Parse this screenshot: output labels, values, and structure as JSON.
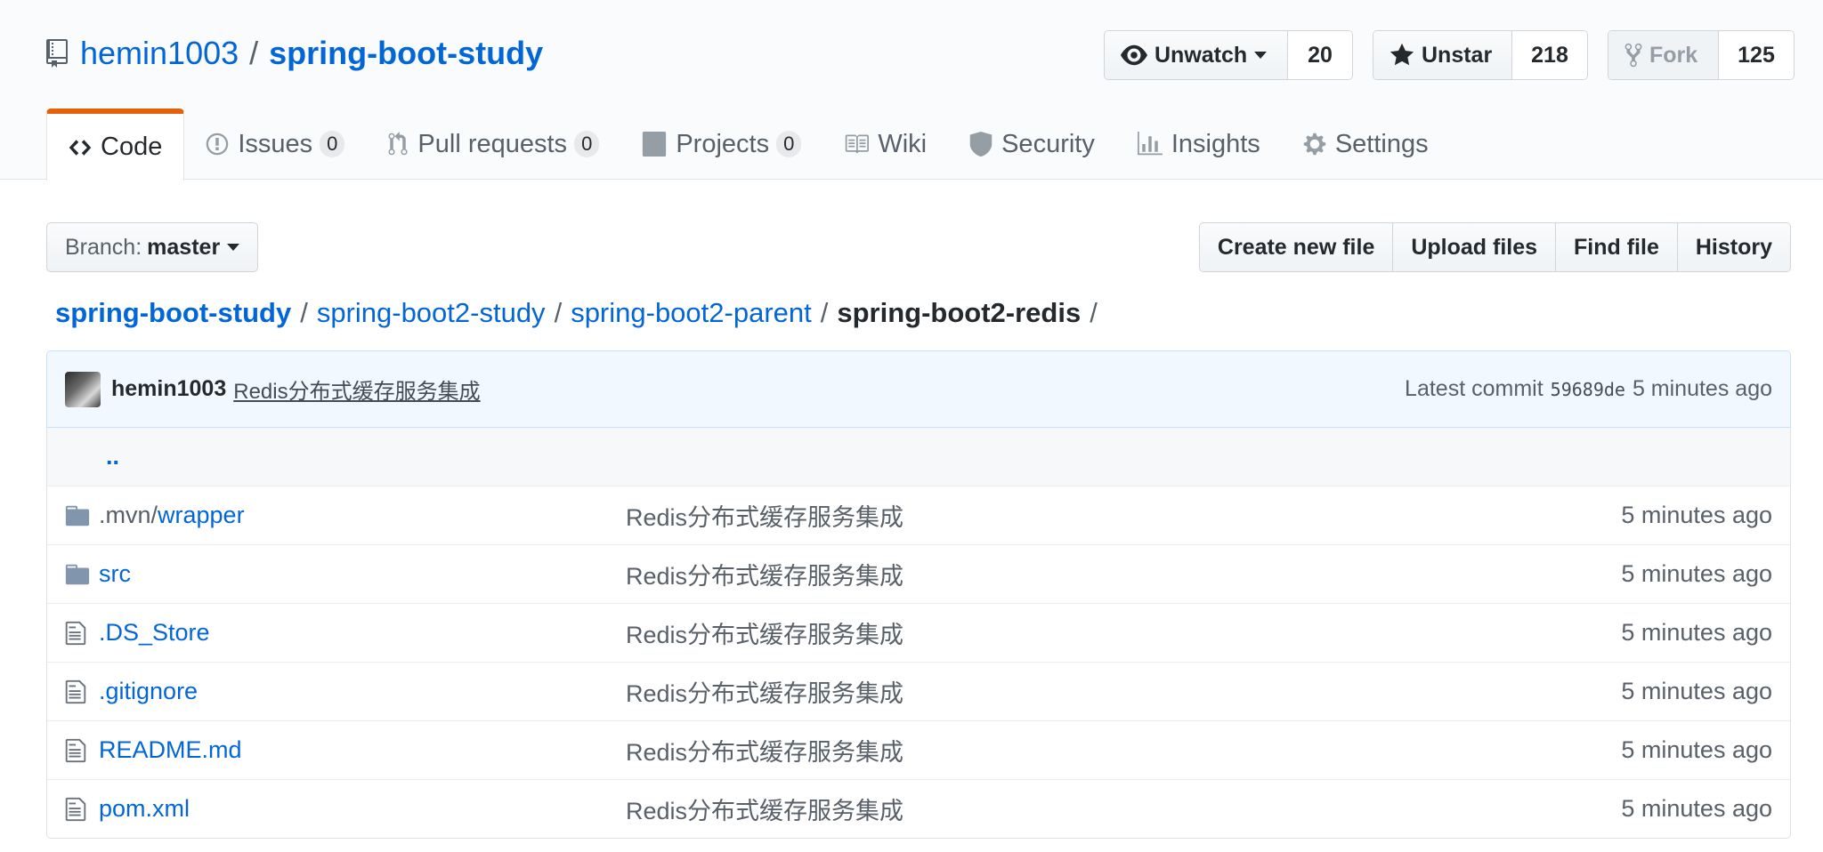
{
  "repo": {
    "owner": "hemin1003",
    "separator": "/",
    "name": "spring-boot-study"
  },
  "actions": [
    {
      "label": "Unwatch",
      "count": "20"
    },
    {
      "label": "Unstar",
      "count": "218"
    },
    {
      "label": "Fork",
      "count": "125"
    }
  ],
  "tabs": [
    {
      "label": "Code"
    },
    {
      "label": "Issues",
      "counter": "0"
    },
    {
      "label": "Pull requests",
      "counter": "0"
    },
    {
      "label": "Projects",
      "counter": "0"
    },
    {
      "label": "Wiki"
    },
    {
      "label": "Security"
    },
    {
      "label": "Insights"
    },
    {
      "label": "Settings"
    }
  ],
  "branch": {
    "label": "Branch:",
    "value": "master"
  },
  "file_nav": [
    "Create new file",
    "Upload files",
    "Find file",
    "History"
  ],
  "breadcrumb": {
    "parts": [
      "spring-boot-study",
      "spring-boot2-study",
      "spring-boot2-parent",
      "spring-boot2-redis"
    ],
    "sep": "/"
  },
  "commit": {
    "author": "hemin1003",
    "message": "Redis分布式缓存服务集成",
    "latest_label": "Latest commit",
    "sha": "59689de",
    "age": "5 minutes ago"
  },
  "files": {
    "up": "..",
    "rows": [
      {
        "type": "folder",
        "dim": ".mvn/",
        "name": "wrapper",
        "message": "Redis分布式缓存服务集成",
        "age": "5 minutes ago"
      },
      {
        "type": "folder",
        "dim": "",
        "name": "src",
        "message": "Redis分布式缓存服务集成",
        "age": "5 minutes ago"
      },
      {
        "type": "file",
        "dim": "",
        "name": ".DS_Store",
        "message": "Redis分布式缓存服务集成",
        "age": "5 minutes ago"
      },
      {
        "type": "file",
        "dim": "",
        "name": ".gitignore",
        "message": "Redis分布式缓存服务集成",
        "age": "5 minutes ago"
      },
      {
        "type": "file",
        "dim": "",
        "name": "README.md",
        "message": "Redis分布式缓存服务集成",
        "age": "5 minutes ago"
      },
      {
        "type": "file",
        "dim": "",
        "name": "pom.xml",
        "message": "Redis分布式缓存服务集成",
        "age": "5 minutes ago"
      }
    ]
  },
  "colors": {
    "link": "#0366d6",
    "accent": "#e36209",
    "commit_bg": "#f1f8ff"
  }
}
